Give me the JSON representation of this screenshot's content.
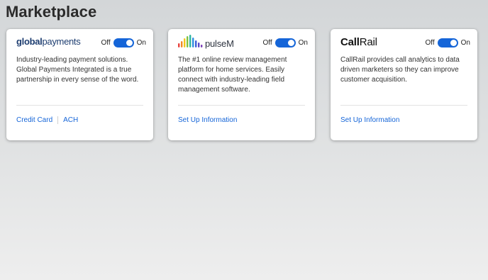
{
  "page": {
    "title": "Marketplace"
  },
  "cards": [
    {
      "logo": {
        "bold": "global",
        "light": "payments",
        "icon": "global-payments-logo"
      },
      "toggle": {
        "off": "Off",
        "on": "On",
        "state": "on"
      },
      "description": "Industry-leading payment solutions. Global Payments Integrated is a true partnership in every sense of the word.",
      "links": [
        "Credit Card",
        "ACH"
      ]
    },
    {
      "logo": {
        "text": "pulseM",
        "icon": "pulsem-logo"
      },
      "toggle": {
        "off": "Off",
        "on": "On",
        "state": "on"
      },
      "description": "The #1 online review management platform for home services. Easily connect with industry-leading field management software.",
      "links": [
        "Set Up Information"
      ]
    },
    {
      "logo": {
        "bold": "Call",
        "light": "Rail",
        "icon": "callrail-logo"
      },
      "toggle": {
        "off": "Off",
        "on": "On",
        "state": "on"
      },
      "description": "CallRail provides call analytics to data driven marketers so they can improve customer acquisition.",
      "links": [
        "Set Up Information"
      ]
    }
  ],
  "colors": {
    "accent": "#1565d8",
    "background": "#dee0e1",
    "card": "#ffffff"
  }
}
